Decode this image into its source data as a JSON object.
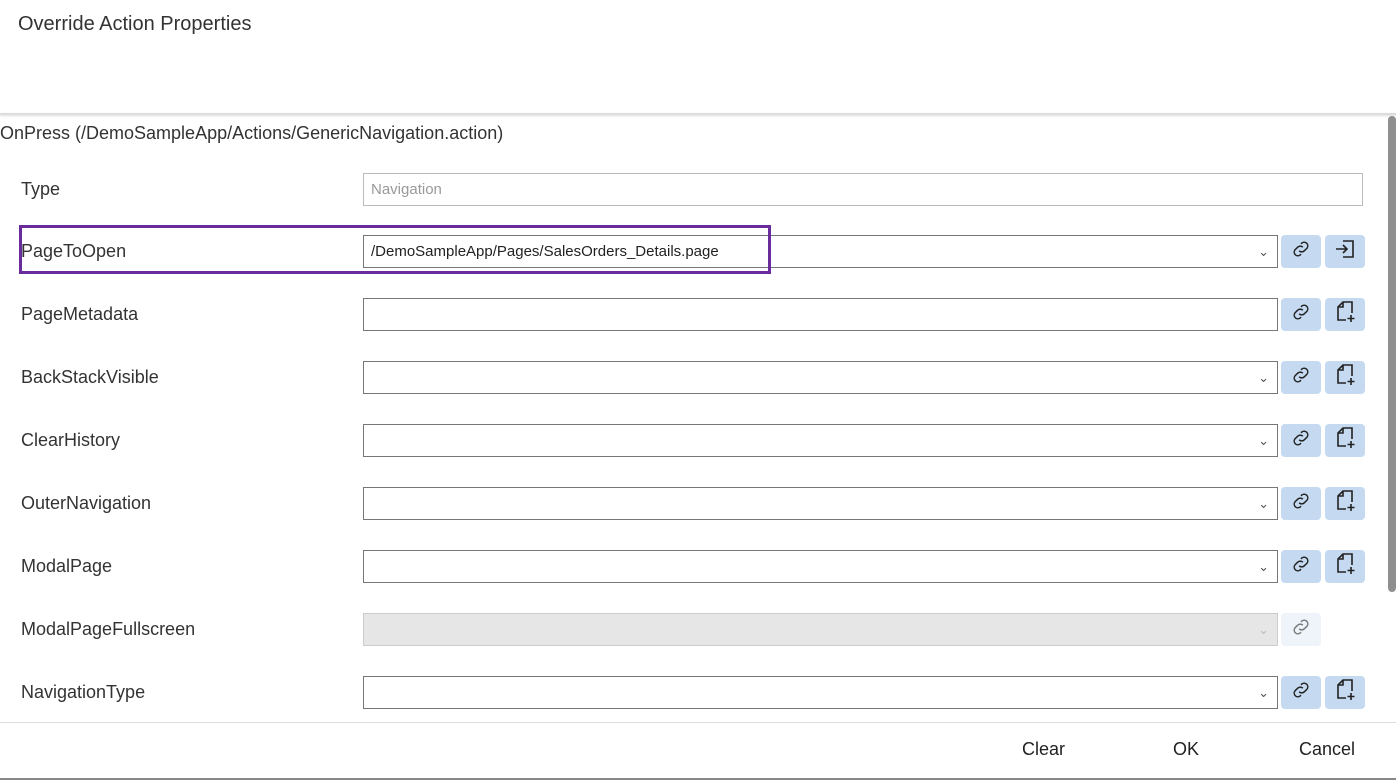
{
  "dialog": {
    "title": "Override Action Properties",
    "section": "OnPress (/DemoSampleApp/Actions/GenericNavigation.action)"
  },
  "type": {
    "label": "Type",
    "placeholder": "Navigation"
  },
  "rows": [
    {
      "label": "PageToOpen",
      "value": "/DemoSampleApp/Pages/SalesOrders_Details.page",
      "icon2": "open-page-icon"
    },
    {
      "label": "PageMetadata",
      "value": "",
      "icon2": "new-file-icon"
    },
    {
      "label": "BackStackVisible",
      "value": "",
      "icon2": "new-file-icon"
    },
    {
      "label": "ClearHistory",
      "value": "",
      "icon2": "new-file-icon"
    },
    {
      "label": "OuterNavigation",
      "value": "",
      "icon2": "new-file-icon"
    },
    {
      "label": "ModalPage",
      "value": "",
      "icon2": "new-file-icon"
    },
    {
      "label": "ModalPageFullscreen",
      "value": "",
      "disabled": true
    },
    {
      "label": "NavigationType",
      "value": "",
      "icon2": "new-file-icon"
    }
  ],
  "footer": {
    "clear": "Clear",
    "ok": "OK",
    "cancel": "Cancel"
  },
  "colors": {
    "highlight": "#6a2c9c",
    "button_bg": "#c5daf0"
  }
}
